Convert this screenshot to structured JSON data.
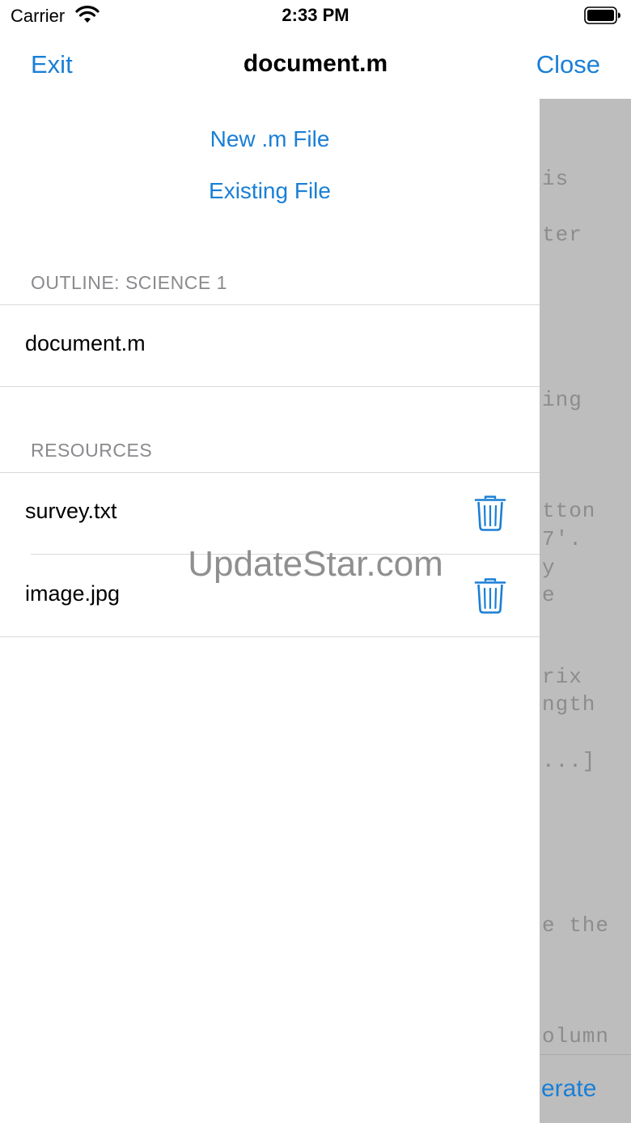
{
  "status_bar": {
    "carrier": "Carrier",
    "time": "2:33 PM"
  },
  "nav": {
    "exit_label": "Exit",
    "title": "document.m",
    "close_label": "Close"
  },
  "actions": {
    "new_file": "New .m File",
    "existing_file": "Existing File"
  },
  "outline": {
    "header": "OUTLINE: SCIENCE 1",
    "items": [
      {
        "label": "document.m"
      }
    ]
  },
  "resources": {
    "header": "RESOURCES",
    "items": [
      {
        "label": "survey.txt",
        "icon": "trash-icon"
      },
      {
        "label": "image.jpg",
        "icon": "trash-icon"
      }
    ]
  },
  "editor_preview": {
    "lines": [
      "is",
      "ter",
      "ing",
      "tton",
      "7'.",
      "y",
      "e",
      "rix",
      "ngth",
      "...]",
      "e the",
      "olumn"
    ],
    "action": "erate"
  },
  "watermark": "UpdateStar.com",
  "colors": {
    "accent": "#1a7fd6",
    "editor_bg": "#bdbdbd",
    "secondary_text": "#8a8a8e"
  }
}
